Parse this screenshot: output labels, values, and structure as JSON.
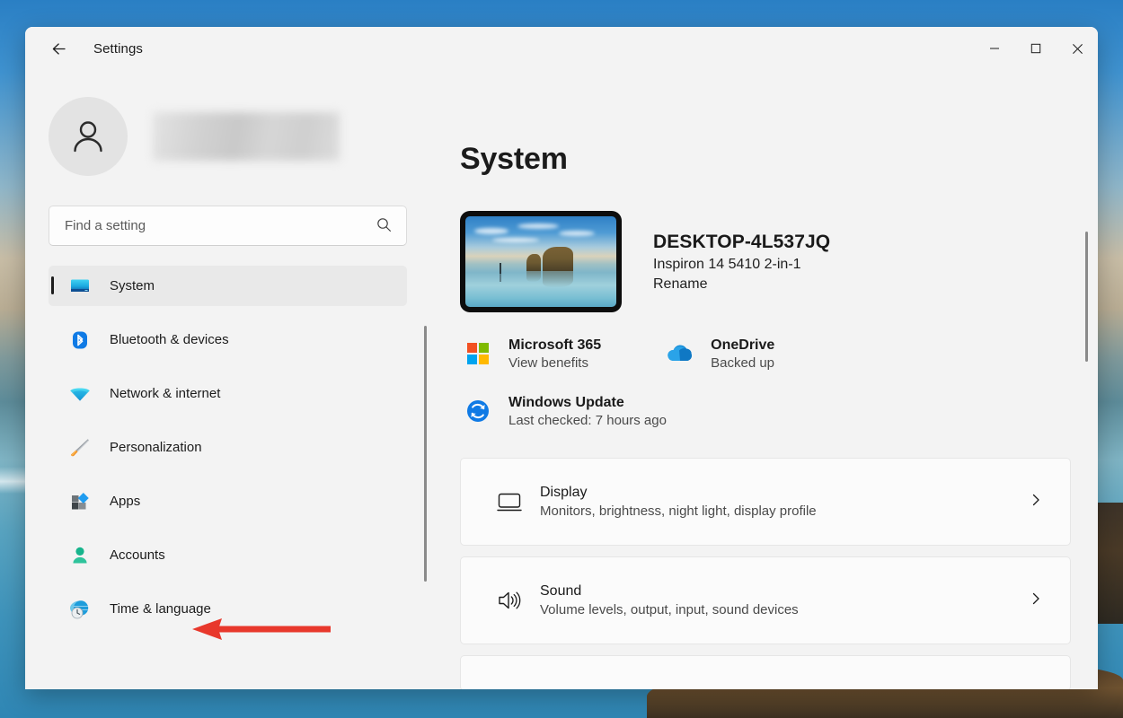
{
  "window": {
    "app_title": "Settings",
    "back_icon": "back-arrow-icon",
    "minimize_label": "—",
    "maximize_label": "□",
    "close_label": "✕"
  },
  "sidebar": {
    "profile": {
      "avatar_icon": "person-avatar-icon",
      "name": ""
    },
    "search": {
      "placeholder": "Find a setting",
      "value": "",
      "icon": "search-icon"
    },
    "items": [
      {
        "label": "System",
        "icon": "monitor-icon",
        "selected": true
      },
      {
        "label": "Bluetooth & devices",
        "icon": "bluetooth-icon",
        "selected": false
      },
      {
        "label": "Network & internet",
        "icon": "wifi-icon",
        "selected": false
      },
      {
        "label": "Personalization",
        "icon": "paintbrush-icon",
        "selected": false
      },
      {
        "label": "Apps",
        "icon": "apps-icon",
        "selected": false
      },
      {
        "label": "Accounts",
        "icon": "person-icon",
        "selected": false
      },
      {
        "label": "Time & language",
        "icon": "globe-clock-icon",
        "selected": false
      }
    ]
  },
  "annotation": {
    "type": "arrow",
    "points_to": "Accounts",
    "color": "#e8382c"
  },
  "main": {
    "page_title": "System",
    "device": {
      "name": "DESKTOP-4L537JQ",
      "model": "Inspiron 14 5410 2-in-1",
      "rename_label": "Rename",
      "thumbnail": "device-wallpaper-thumbnail"
    },
    "quick_links": [
      {
        "title": "Microsoft 365",
        "subtitle": "View benefits",
        "icon": "microsoft-logo-icon"
      },
      {
        "title": "OneDrive",
        "subtitle": "Backed up",
        "icon": "onedrive-cloud-icon"
      },
      {
        "title": "Windows Update",
        "subtitle": "Last checked: 7 hours ago",
        "icon": "windows-update-icon"
      }
    ],
    "cards": [
      {
        "title": "Display",
        "subtitle": "Monitors, brightness, night light, display profile",
        "icon": "display-monitor-icon",
        "chevron": "chevron-right-icon"
      },
      {
        "title": "Sound",
        "subtitle": "Volume levels, output, input, sound devices",
        "icon": "speaker-icon",
        "chevron": "chevron-right-icon"
      }
    ]
  },
  "colors": {
    "window_bg": "#f3f3f3",
    "card_bg": "#fbfbfb",
    "accent_blue": "#0078d4",
    "annotation_red": "#e8382c",
    "selected_nav_bg": "#e9e9e9"
  }
}
